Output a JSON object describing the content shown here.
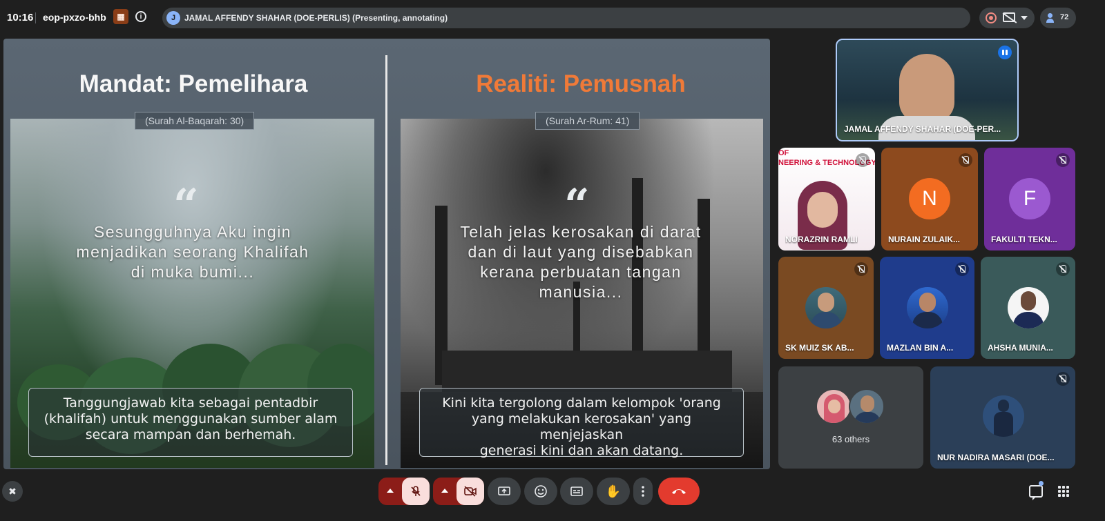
{
  "topbar": {
    "time": "10:16",
    "meeting_code": "eop-pxzo-bhb",
    "presenter_initial": "J",
    "presenter_text": "JAMAL AFFENDY SHAHAR (DOE-PERLIS) (Presenting, annotating)",
    "participant_count": "72"
  },
  "slide": {
    "left": {
      "title": "Mandat: Pemelihara",
      "citation": "(Surah Al-Baqarah: 30)",
      "quote_mark": "“",
      "quote_lines": [
        "Sesungguhnya Aku ingin",
        "menjadikan seorang Khalifah",
        "di muka bumi..."
      ],
      "note_lines": [
        "Tanggungjawab kita sebagai pentadbir",
        "(khalifah) untuk menggunakan sumber alam",
        "secara mampan dan berhemah."
      ]
    },
    "right": {
      "title": "Realiti: Pemusnah",
      "citation": "(Surah Ar-Rum: 41)",
      "quote_mark": "“",
      "quote_lines": [
        "Telah jelas kerosakan di darat",
        "dan di laut yang disebabkan",
        "kerana perbuatan tangan",
        "manusia..."
      ],
      "note_lines": [
        "Kini kita tergolong dalam kelompok 'orang",
        "yang melakukan kerosakan' yang menjejaskan",
        "generasi kini dan akan datang."
      ]
    }
  },
  "participants": {
    "main": "JAMAL AFFENDY SHAHAR (DOE-PER...",
    "norazrin": {
      "name": "NORAZRIN RAMLI",
      "banner1": "OF",
      "banner2": "NEERING & TECHNOLOGY"
    },
    "nurain": {
      "name": "NURAIN ZULAIK...",
      "initial": "N"
    },
    "fakulti": {
      "name": "FAKULTI TEKN...",
      "initial": "F"
    },
    "skmuiz": {
      "name": "SK MUIZ SK AB..."
    },
    "mazlan": {
      "name": "MAZLAN BIN A..."
    },
    "ahsha": {
      "name": "AHSHA MUNIA..."
    },
    "others": {
      "label": "63 others"
    },
    "nadira": {
      "name": "NUR NADIRA MASARI (DOE..."
    }
  },
  "colors": {
    "background": "#1f1f1f",
    "accent_orange": "#f07a38",
    "end_call_red": "#e33b2e",
    "nurain_tile": "#8d4a1e",
    "fakulti_tile": "#6f2e9a"
  }
}
